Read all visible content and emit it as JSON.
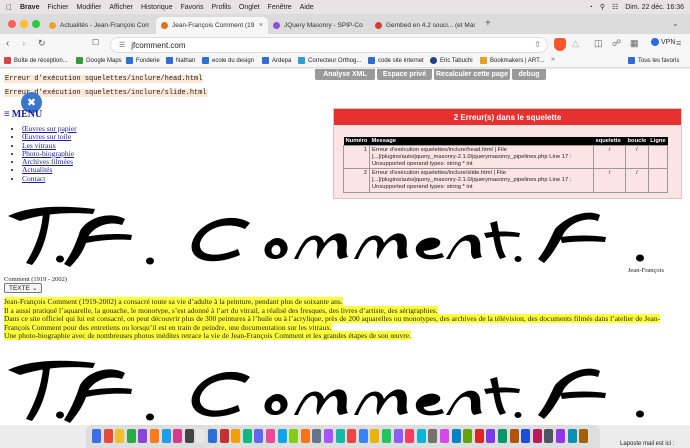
{
  "menubar": {
    "app": "Brave",
    "items": [
      "Fichier",
      "Modifier",
      "Afficher",
      "Historique",
      "Favoris",
      "Profils",
      "Onglet",
      "Fenêtre",
      "Aide"
    ],
    "datetime": "Dim. 22 déc.  16:36"
  },
  "tabs": [
    {
      "label": "Actualités - Jean-François Comment (19",
      "color": "#f0a030"
    },
    {
      "label": "Jean-François Comment (19...",
      "color": "#e07020"
    },
    {
      "label": "JQuery Masonry - SPIP-Contrib",
      "color": "#8c4fd6"
    },
    {
      "label": "Gembed en 4.2 souci... (et Mason",
      "color": "#d23b3b"
    }
  ],
  "address": {
    "url": "jfcomment.com"
  },
  "vpn_label": "VPN",
  "bookmarks": [
    {
      "label": "Boîte de réception...",
      "color": "#d44"
    },
    {
      "label": "Google Maps",
      "color": "#3a9a3a"
    },
    {
      "label": "Fonderie",
      "color": "#2c6ed8"
    },
    {
      "label": "Nathan",
      "color": "#2c6ed8"
    },
    {
      "label": "ecole du design",
      "color": "#2c6ed8"
    },
    {
      "label": "Ardepa",
      "color": "#2c6ed8"
    },
    {
      "label": "Correcteur Orthog...",
      "color": "#2a9fd0"
    },
    {
      "label": "code site internet",
      "color": "#2c6ed8"
    },
    {
      "label": "Eric Tabuchi",
      "color": "#1f3f8a"
    },
    {
      "label": "Bookmakers | ART...",
      "color": "#e8a020"
    }
  ],
  "bookmarks_all": "Tous les favoris",
  "page": {
    "errors_top": [
      "Erreur d’exécution squelettes/inclure/head.html",
      "Erreur d’exécution squelettes/inclure/slide.html"
    ],
    "debug_buttons": [
      "Analyse XML",
      "Espace privé",
      "Recalculer cette page",
      "debug"
    ],
    "menu_label": "MENU",
    "menu_items": [
      "Œuvres sur papier",
      "Œuvres sur toile",
      "Les vitraux",
      "Photo-biographie",
      "Archives filmées",
      "Actualités",
      "Contact"
    ],
    "error_panel": {
      "title": "2 Erreur(s) dans le squelette",
      "headers": [
        "Numéro",
        "Message",
        "squelette",
        "boucle",
        "Ligne"
      ],
      "rows": [
        {
          "num": "1",
          "message": "Erreur d’exécution squelettes/inclure/head.html | File [...]/plugins/auto/jquery_masonry-2.1.0/jquerymasonry_pipelines.php Line 17 : Unsupported operand types: string * int",
          "squelette": "/",
          "boucle": "/",
          "ligne": ""
        },
        {
          "num": "2",
          "message": "Erreur d’exécution squelettes/inclure/slide.html | File [...]/plugins/auto/jquery_masonry-2.1.0/jquerymasonry_pipelines.php Line 17 : Unsupported operand types: string * int",
          "squelette": "/",
          "boucle": "/",
          "ligne": ""
        }
      ]
    },
    "signature_credit": "Jean-François",
    "life_tag": "Comment (1919 - 2002)",
    "texte_button": "TEXTE",
    "bio": [
      "Jean-François Comment (1919-2002) a consacré toute sa vie d’adulte à la peinture, pendant plus de soixante ans.",
      "Il a aussi pratiqué l’aquarelle, la gouache, le monotype, s’est adonné à l’art du vitrail, a réalisé des fresques, des livres d’artiste, des sérigraphies.",
      "Dans ce site officiel qui lui est consacré, on peut découvrir plus de 300 peintures à l’huile ou à l’acrylique, près de 200 aquarelles ou monotypes, des archives de la télévision, des documents filmés dans l’atelier de Jean-François Comment pour des entretiens ou lorsqu’il est en train de peindre, une documentation sur les vitraux.",
      "Une photo-biographie avec de nombreuses photos inédites retrace la vie de Jean-François Comment et les grandes étapes de son œuvre."
    ]
  },
  "dock_popup": "Laposte mail est ici :"
}
